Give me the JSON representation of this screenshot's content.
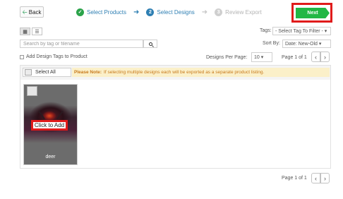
{
  "header": {
    "back_label": "Back",
    "next_label": "Next"
  },
  "steps": [
    {
      "label": "Select Products",
      "state": "done",
      "icon": "check-circle-icon"
    },
    {
      "label": "Select Designs",
      "state": "active",
      "number": "2"
    },
    {
      "label": "Review Export",
      "state": "upcoming",
      "number": "3"
    }
  ],
  "toolbar": {
    "tags_label": "Tags:",
    "tags_value": "- Select Tag To Filter -",
    "search_placeholder": "Search by tag or filename",
    "sort_label": "Sort By:",
    "sort_value": "Date: New-Old",
    "add_tags_label": "Add Design Tags to Product",
    "per_page_label": "Designs Per Page:",
    "per_page_value": "10",
    "page_text": "Page 1 of 1"
  },
  "panel": {
    "select_all_label": "Select All",
    "note_bold": "Please Note:",
    "note_text": "If selecting multiple designs each will be exported as a separate product listing."
  },
  "designs": [
    {
      "name": "deer",
      "action_label": "Click to Add"
    }
  ],
  "footer": {
    "page_text": "Page 1 of 1"
  },
  "colors": {
    "accent_green": "#22b745",
    "step_blue": "#2e7fb3",
    "highlight_red": "#e01b1b",
    "note_background": "#fbf0c9",
    "note_text": "#c7791c"
  }
}
